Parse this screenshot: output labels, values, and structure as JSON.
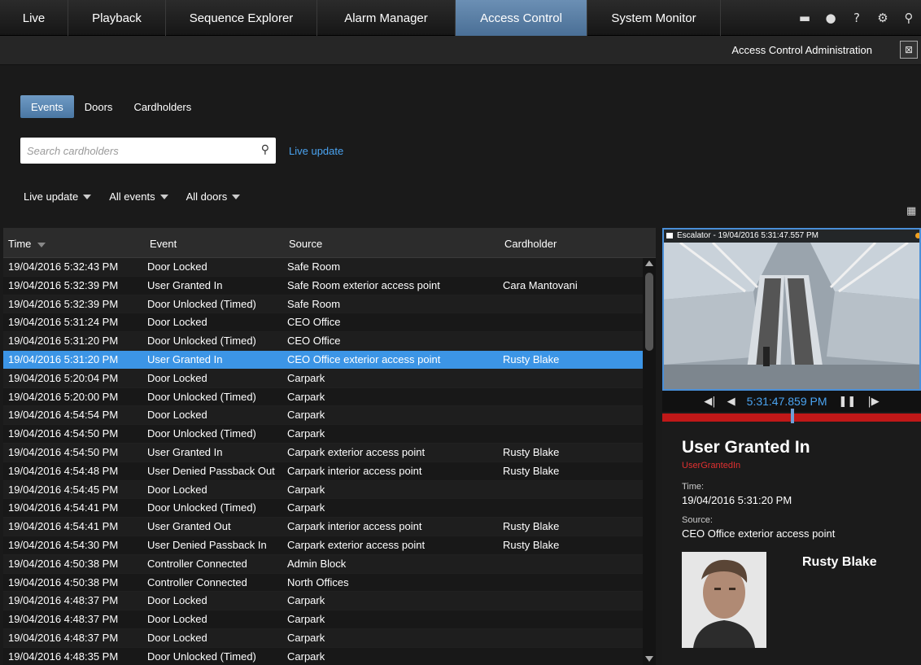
{
  "nav": {
    "tabs": [
      {
        "label": "Live",
        "active": false
      },
      {
        "label": "Playback",
        "active": false
      },
      {
        "label": "Sequence Explorer",
        "active": false
      },
      {
        "label": "Alarm Manager",
        "active": false
      },
      {
        "label": "Access Control",
        "active": true
      },
      {
        "label": "System Monitor",
        "active": false
      }
    ],
    "icons": [
      "server-connect-icon",
      "link-icon",
      "help-icon",
      "settings-icon",
      "pin-icon"
    ]
  },
  "subheader": {
    "title": "Access Control Administration",
    "maximize_icon": "maximize-icon"
  },
  "subtabs": [
    {
      "label": "Events",
      "active": true
    },
    {
      "label": "Doors",
      "active": false
    },
    {
      "label": "Cardholders",
      "active": false
    }
  ],
  "search": {
    "placeholder": "Search cardholders",
    "value": "",
    "icon": "search-icon"
  },
  "live_update_link": "Live update",
  "filters": [
    {
      "label": "Live update"
    },
    {
      "label": "All events"
    },
    {
      "label": "All doors"
    }
  ],
  "table": {
    "headers": {
      "time": "Time",
      "event": "Event",
      "source": "Source",
      "cardholder": "Cardholder"
    },
    "rows": [
      {
        "time": "19/04/2016 5:32:43 PM",
        "event": "Door Locked",
        "source": "Safe Room",
        "cardholder": ""
      },
      {
        "time": "19/04/2016 5:32:39 PM",
        "event": "User Granted In",
        "source": "Safe Room exterior access point",
        "cardholder": "Cara Mantovani"
      },
      {
        "time": "19/04/2016 5:32:39 PM",
        "event": "Door Unlocked (Timed)",
        "source": "Safe Room",
        "cardholder": ""
      },
      {
        "time": "19/04/2016 5:31:24 PM",
        "event": "Door Locked",
        "source": "CEO Office",
        "cardholder": ""
      },
      {
        "time": "19/04/2016 5:31:20 PM",
        "event": "Door Unlocked (Timed)",
        "source": "CEO Office",
        "cardholder": ""
      },
      {
        "time": "19/04/2016 5:31:20 PM",
        "event": "User Granted In",
        "source": "CEO Office exterior access point",
        "cardholder": "Rusty Blake",
        "selected": true
      },
      {
        "time": "19/04/2016 5:20:04 PM",
        "event": "Door Locked",
        "source": "Carpark",
        "cardholder": ""
      },
      {
        "time": "19/04/2016 5:20:00 PM",
        "event": "Door Unlocked (Timed)",
        "source": "Carpark",
        "cardholder": ""
      },
      {
        "time": "19/04/2016 4:54:54 PM",
        "event": "Door Locked",
        "source": "Carpark",
        "cardholder": ""
      },
      {
        "time": "19/04/2016 4:54:50 PM",
        "event": "Door Unlocked (Timed)",
        "source": "Carpark",
        "cardholder": ""
      },
      {
        "time": "19/04/2016 4:54:50 PM",
        "event": "User Granted In",
        "source": "Carpark exterior access point",
        "cardholder": "Rusty Blake"
      },
      {
        "time": "19/04/2016 4:54:48 PM",
        "event": "User Denied Passback Out",
        "source": "Carpark interior access point",
        "cardholder": "Rusty Blake"
      },
      {
        "time": "19/04/2016 4:54:45 PM",
        "event": "Door Locked",
        "source": "Carpark",
        "cardholder": ""
      },
      {
        "time": "19/04/2016 4:54:41 PM",
        "event": "Door Unlocked (Timed)",
        "source": "Carpark",
        "cardholder": ""
      },
      {
        "time": "19/04/2016 4:54:41 PM",
        "event": "User Granted Out",
        "source": "Carpark interior access point",
        "cardholder": "Rusty Blake"
      },
      {
        "time": "19/04/2016 4:54:30 PM",
        "event": "User Denied Passback In",
        "source": "Carpark exterior access point",
        "cardholder": "Rusty Blake"
      },
      {
        "time": "19/04/2016 4:50:38 PM",
        "event": "Controller Connected",
        "source": "Admin Block",
        "cardholder": ""
      },
      {
        "time": "19/04/2016 4:50:38 PM",
        "event": "Controller Connected",
        "source": "North Offices",
        "cardholder": ""
      },
      {
        "time": "19/04/2016 4:48:37 PM",
        "event": "Door Locked",
        "source": "Carpark",
        "cardholder": ""
      },
      {
        "time": "19/04/2016 4:48:37 PM",
        "event": "Door Locked",
        "source": "Carpark",
        "cardholder": ""
      },
      {
        "time": "19/04/2016 4:48:37 PM",
        "event": "Door Locked",
        "source": "Carpark",
        "cardholder": ""
      },
      {
        "time": "19/04/2016 4:48:35 PM",
        "event": "Door Unlocked (Timed)",
        "source": "Carpark",
        "cardholder": ""
      }
    ]
  },
  "video": {
    "caption": "Escalator - 19/04/2016 5:31:47.557 PM",
    "playback_time": "5:31:47.859 PM"
  },
  "detail": {
    "event_title": "User Granted In",
    "event_code": "UserGrantedIn",
    "time_label": "Time:",
    "time_value": "19/04/2016 5:31:20 PM",
    "source_label": "Source:",
    "source_value": "CEO Office exterior access point",
    "cardholder_name": "Rusty Blake"
  },
  "colors": {
    "accent": "#3c95e6",
    "active_tab": "#5a80a8",
    "link": "#4aa3f0",
    "event_code": "#e03030",
    "timeline": "#c01818"
  }
}
